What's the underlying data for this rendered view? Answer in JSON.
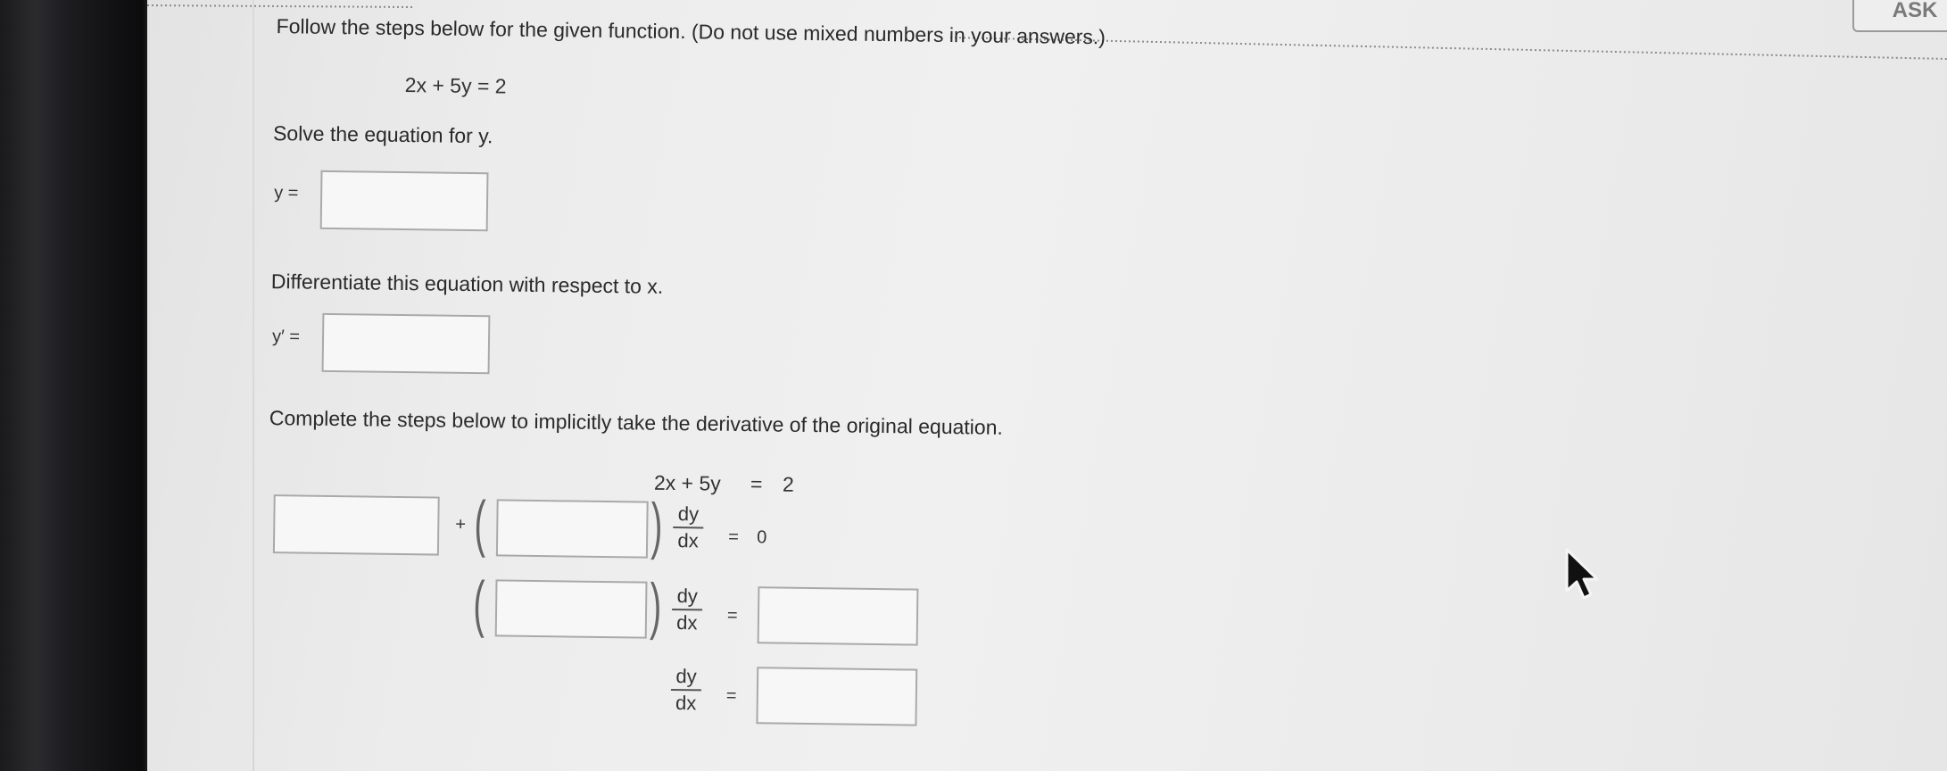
{
  "header_button": {
    "label": "ASK"
  },
  "problem": {
    "instruction": "Follow the steps below for the given function. (Do not use mixed numbers in your answers.)",
    "equation": "2x + 5y = 2"
  },
  "step1": {
    "prompt": "Solve the equation for y.",
    "label": "y ="
  },
  "step2": {
    "prompt": "Differentiate this equation with respect to x.",
    "label": "y′ ="
  },
  "step3": {
    "prompt": "Complete the steps below to implicitly take the derivative of the original equation.",
    "eq_lhs": "2x + 5y",
    "eq_sign": "=",
    "eq_rhs": "2",
    "plus": "+",
    "dy": "dy",
    "dx": "dx",
    "equals": "=",
    "zero": "0"
  }
}
